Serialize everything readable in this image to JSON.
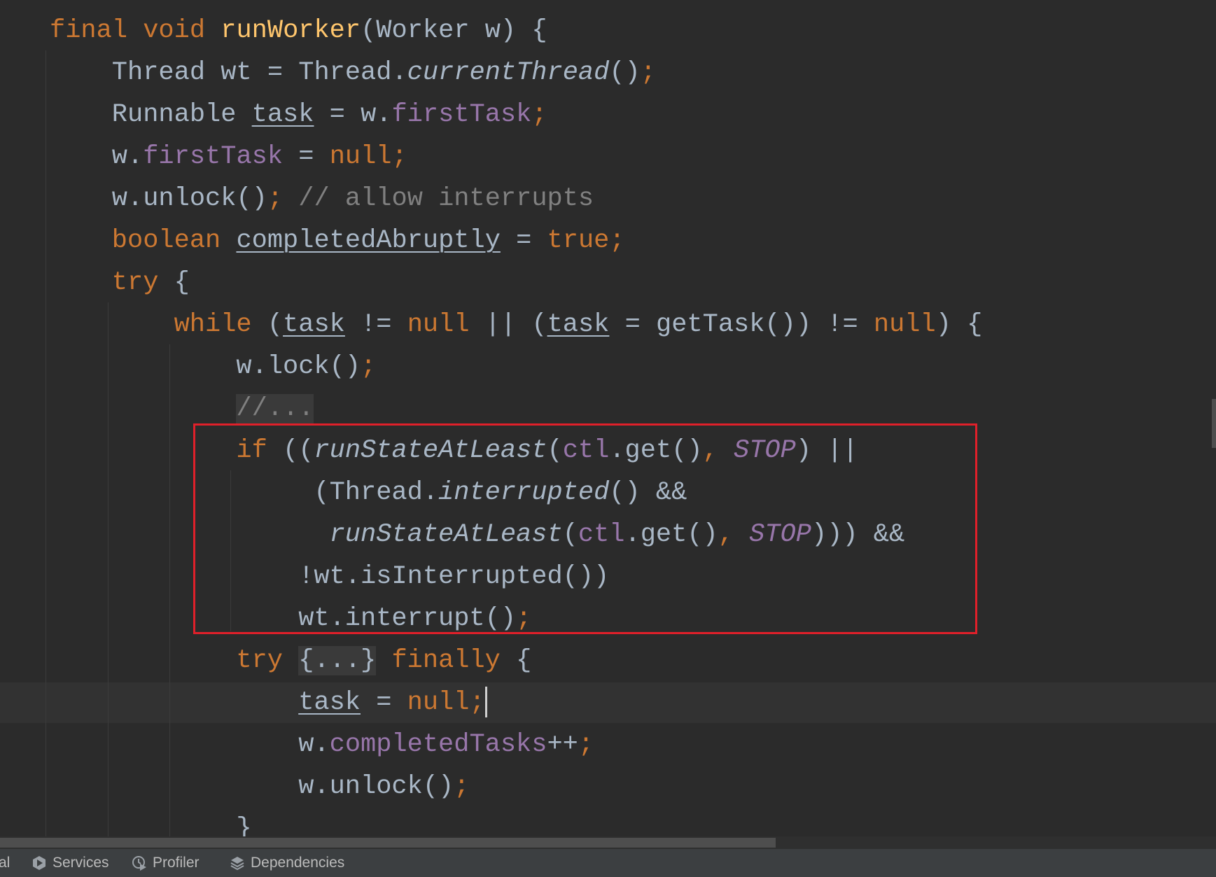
{
  "colors": {
    "background": "#2b2b2b",
    "keyword": "#cc7832",
    "text": "#a9b7c6",
    "field": "#9876aa",
    "method_declaration": "#ffc66d",
    "comment": "#808080",
    "highlight_box": "#e0202a"
  },
  "code_lines": [
    {
      "indent": 0,
      "tokens": [
        [
          "final void ",
          "k"
        ],
        [
          "runWorker",
          "m"
        ],
        [
          "(Worker w) {",
          "p"
        ]
      ]
    },
    {
      "indent": 4,
      "tokens": [
        [
          "Thread wt = Thread.",
          "p"
        ],
        [
          "currentThread",
          "i"
        ],
        [
          "()",
          "p"
        ],
        [
          ";",
          "k"
        ]
      ]
    },
    {
      "indent": 4,
      "tokens": [
        [
          "Runnable ",
          "p"
        ],
        [
          "task",
          "u"
        ],
        [
          " = w.",
          "p"
        ],
        [
          "firstTask",
          "f"
        ],
        [
          ";",
          "k"
        ]
      ]
    },
    {
      "indent": 4,
      "tokens": [
        [
          "w.",
          "p"
        ],
        [
          "firstTask",
          "f"
        ],
        [
          " = ",
          "p"
        ],
        [
          "null;",
          "k"
        ]
      ]
    },
    {
      "indent": 4,
      "tokens": [
        [
          "w.unlock()",
          "p"
        ],
        [
          "; ",
          "k"
        ],
        [
          "// allow interrupts",
          "cm"
        ]
      ]
    },
    {
      "indent": 4,
      "tokens": [
        [
          "boolean ",
          "k"
        ],
        [
          "completedAbruptly",
          "u"
        ],
        [
          " = ",
          "p"
        ],
        [
          "true;",
          "k"
        ]
      ]
    },
    {
      "indent": 4,
      "tokens": [
        [
          "try ",
          "k"
        ],
        [
          "{",
          "p"
        ]
      ]
    },
    {
      "indent": 8,
      "tokens": [
        [
          "while ",
          "k"
        ],
        [
          "(",
          "p"
        ],
        [
          "task",
          "u"
        ],
        [
          " != ",
          "p"
        ],
        [
          "null",
          "k"
        ],
        [
          " || (",
          "p"
        ],
        [
          "task",
          "u"
        ],
        [
          " = getTask()) != ",
          "p"
        ],
        [
          "null",
          "k"
        ],
        [
          ") {",
          "p"
        ]
      ]
    },
    {
      "indent": 12,
      "tokens": [
        [
          "w.lock()",
          "p"
        ],
        [
          ";",
          "k"
        ]
      ]
    },
    {
      "indent": 12,
      "tokens": [
        [
          "//...",
          "cm fold"
        ]
      ]
    },
    {
      "indent": 12,
      "tokens": [
        [
          "if ",
          "k"
        ],
        [
          "((",
          "p"
        ],
        [
          "runStateAtLeast",
          "i"
        ],
        [
          "(",
          "p"
        ],
        [
          "ctl",
          "f"
        ],
        [
          ".get()",
          "p"
        ],
        [
          ", ",
          "k"
        ],
        [
          "STOP",
          "fi"
        ],
        [
          ") ||",
          "p"
        ]
      ]
    },
    {
      "indent": 17,
      "tokens": [
        [
          "(Thread.",
          "p"
        ],
        [
          "interrupted",
          "i"
        ],
        [
          "() &&",
          "p"
        ]
      ]
    },
    {
      "indent": 18,
      "tokens": [
        [
          "runStateAtLeast",
          "i"
        ],
        [
          "(",
          "p"
        ],
        [
          "ctl",
          "f"
        ],
        [
          ".get()",
          "p"
        ],
        [
          ", ",
          "k"
        ],
        [
          "STOP",
          "fi"
        ],
        [
          "))) &&",
          "p"
        ]
      ]
    },
    {
      "indent": 16,
      "tokens": [
        [
          "!wt.isInterrupted())",
          "p"
        ]
      ]
    },
    {
      "indent": 16,
      "tokens": [
        [
          "wt.interrupt()",
          "p"
        ],
        [
          ";",
          "k"
        ]
      ]
    },
    {
      "indent": 12,
      "tokens": [
        [
          "try ",
          "k"
        ],
        [
          "{...}",
          "p fold"
        ],
        [
          " finally ",
          "k"
        ],
        [
          "{",
          "p"
        ]
      ]
    },
    {
      "indent": 16,
      "tokens": [
        [
          "task",
          "u"
        ],
        [
          " = ",
          "p"
        ],
        [
          "null;",
          "k"
        ]
      ],
      "caret": true
    },
    {
      "indent": 16,
      "tokens": [
        [
          "w.",
          "p"
        ],
        [
          "completedTasks",
          "f"
        ],
        [
          "++",
          "p"
        ],
        [
          ";",
          "k"
        ]
      ]
    },
    {
      "indent": 16,
      "tokens": [
        [
          "w.unlock()",
          "p"
        ],
        [
          ";",
          "k"
        ]
      ]
    },
    {
      "indent": 12,
      "tokens": [
        [
          "}",
          "p"
        ]
      ]
    }
  ],
  "bottom_bar": {
    "partial_label": "al",
    "tools": [
      {
        "label": "Services",
        "icon": "services-icon"
      },
      {
        "label": "Profiler",
        "icon": "profiler-icon"
      },
      {
        "label": "Dependencies",
        "icon": "dependencies-icon"
      }
    ]
  }
}
